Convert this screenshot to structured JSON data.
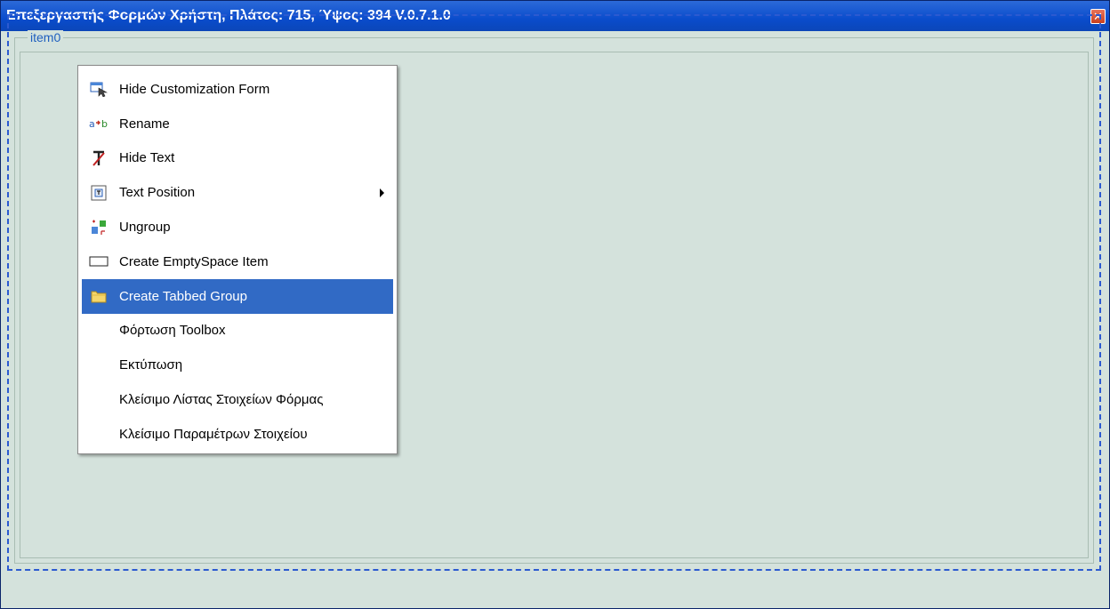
{
  "window": {
    "title": "Επεξεργαστής Φορμών Χρήστη, Πλάτος: 715, Ύψος: 394 V.0.7.1.0",
    "close_label": "✕"
  },
  "layout": {
    "group_caption": "item0"
  },
  "context_menu": {
    "items": [
      {
        "label": "Hide Customization Form",
        "icon": "hide-form-icon"
      },
      {
        "label": "Rename",
        "icon": "rename-icon"
      },
      {
        "label": "Hide Text",
        "icon": "hide-text-icon"
      },
      {
        "label": "Text Position",
        "icon": "text-position-icon",
        "has_submenu": true
      },
      {
        "label": "Ungroup",
        "icon": "ungroup-icon"
      },
      {
        "label": "Create EmptySpace Item",
        "icon": "empty-space-icon"
      },
      {
        "label": "Create Tabbed Group",
        "icon": "folder-icon",
        "selected": true
      },
      {
        "label": "Φόρτωση Toolbox"
      },
      {
        "label": "Εκτύπωση"
      },
      {
        "label": "Κλείσιμο Λίστας Στοιχείων Φόρμας"
      },
      {
        "label": "Κλείσιμο Παραμέτρων Στοιχείου"
      }
    ]
  },
  "colors": {
    "titlebar": "#0a4ccc",
    "background": "#d4e2dc",
    "selection": "#316ac5",
    "frame": "#2c5ad0",
    "caption": "#1f5fbf"
  }
}
